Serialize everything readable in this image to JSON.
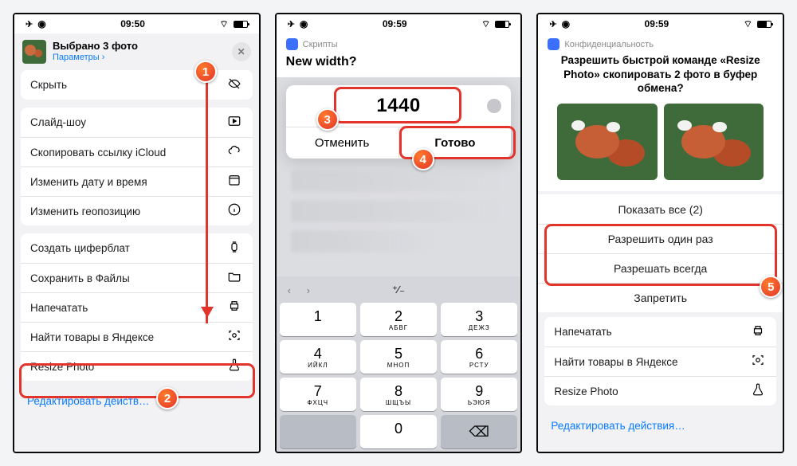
{
  "status": {
    "time1": "09:50",
    "time2": "09:59",
    "time3": "09:59"
  },
  "p1": {
    "title": "Выбрано 3 фото",
    "params": "Параметры ›",
    "rows": [
      "Скрыть",
      "Слайд-шоу",
      "Скопировать ссылку iCloud",
      "Изменить дату и время",
      "Изменить геопозицию",
      "Создать циферблат",
      "Сохранить в Файлы",
      "Напечатать",
      "Найти товары в Яндексе",
      "Resize Photo"
    ],
    "edit": "Редактировать действ…"
  },
  "p2": {
    "app": "Скрипты",
    "question": "New width?",
    "value": "1440",
    "cancel": "Отменить",
    "done": "Готово",
    "keys": {
      "k1": "1",
      "k2": "2",
      "k2l": "АБВГ",
      "k3": "3",
      "k3l": "ДЕЖЗ",
      "k4": "4",
      "k4l": "ИЙКЛ",
      "k5": "5",
      "k5l": "МНОП",
      "k6": "6",
      "k6l": "РСТУ",
      "k7": "7",
      "k7l": "ФХЦЧ",
      "k8": "8",
      "k8l": "ШЩЪЫ",
      "k9": "9",
      "k9l": "ЬЭЮЯ",
      "k0": "0",
      "ksym": "⌫",
      "toggle": "⁺∕₋"
    }
  },
  "p3": {
    "app": "Конфиденциальность",
    "title": "Разрешить быстрой команде «Resize Photo» скопировать 2 фото в буфер обмена?",
    "show_all": "Показать все (2)",
    "allow_once": "Разрешить один раз",
    "allow_always": "Разрешать всегда",
    "deny": "Запретить",
    "lower": [
      "Напечатать",
      "Найти товары в Яндексе",
      "Resize Photo"
    ],
    "edit": "Редактировать действия…"
  },
  "badges": {
    "b1": "1",
    "b2": "2",
    "b3": "3",
    "b4": "4",
    "b5": "5"
  }
}
